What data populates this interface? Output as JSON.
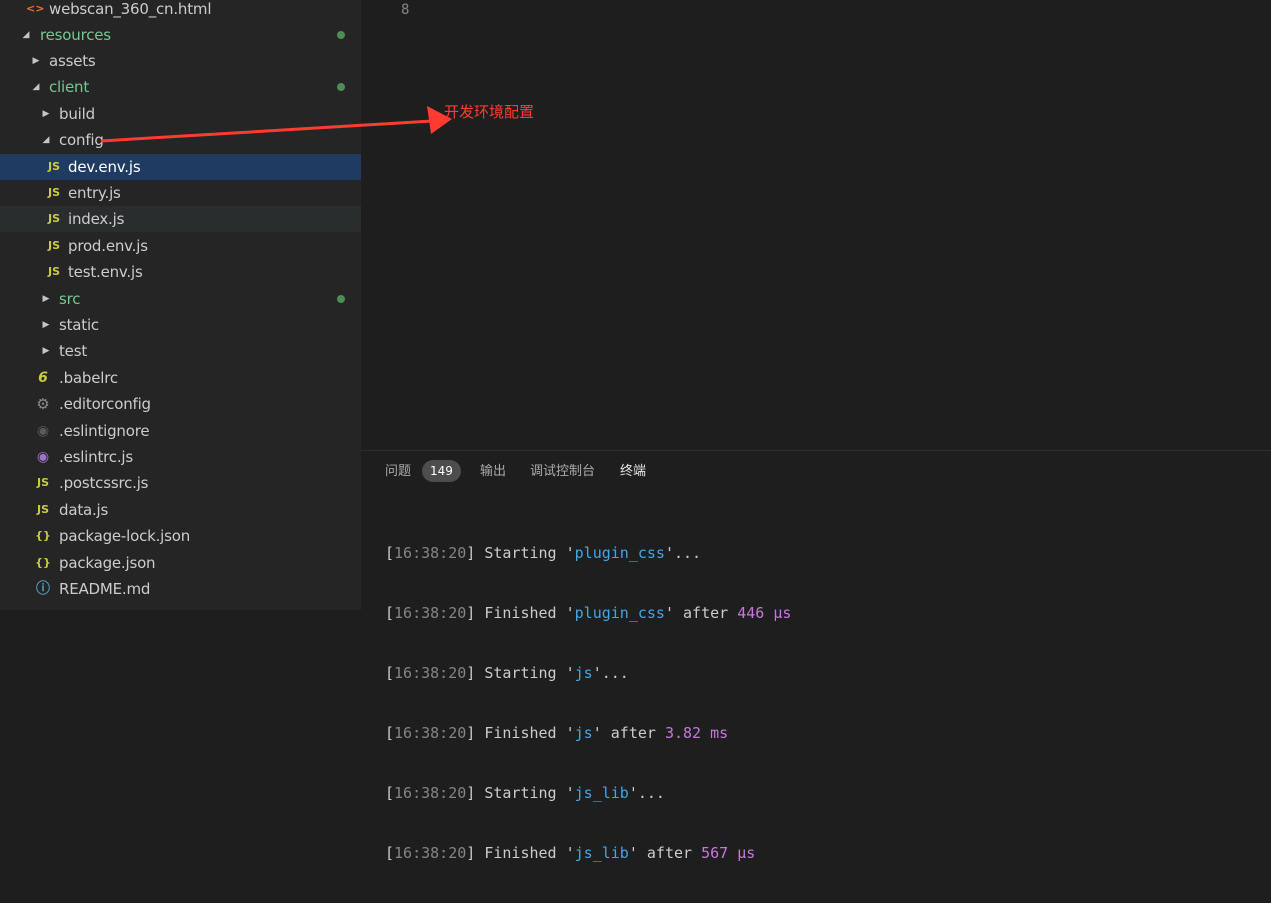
{
  "colors": {
    "accent_selected": "#1f3b61",
    "modified_green": "#73c991",
    "js_yellow": "#cbcb41",
    "annotation_red": "#ff3b30",
    "terminal_cyan": "#3ea8e6",
    "terminal_magenta": "#c678dd"
  },
  "sidebar": {
    "items": [
      {
        "label": "webscan_360_cn.html",
        "icon": "html-code-icon",
        "twisty": ""
      },
      {
        "label": "resources",
        "icon": "",
        "twisty": "◢",
        "modified": true
      },
      {
        "label": "assets",
        "icon": "",
        "twisty": "▶"
      },
      {
        "label": "client",
        "icon": "",
        "twisty": "◢",
        "modified": true
      },
      {
        "label": "build",
        "icon": "",
        "twisty": "▶"
      },
      {
        "label": "config",
        "icon": "",
        "twisty": "◢"
      },
      {
        "label": "dev.env.js",
        "icon": "JS",
        "twisty": "",
        "selected": true
      },
      {
        "label": "entry.js",
        "icon": "JS",
        "twisty": ""
      },
      {
        "label": "index.js",
        "icon": "JS",
        "twisty": "",
        "hover": true
      },
      {
        "label": "prod.env.js",
        "icon": "JS",
        "twisty": ""
      },
      {
        "label": "test.env.js",
        "icon": "JS",
        "twisty": ""
      },
      {
        "label": "src",
        "icon": "",
        "twisty": "▶",
        "modified": true
      },
      {
        "label": "static",
        "icon": "",
        "twisty": "▶"
      },
      {
        "label": "test",
        "icon": "",
        "twisty": "▶"
      },
      {
        "label": ".babelrc",
        "icon": "6",
        "twisty": ""
      },
      {
        "label": ".editorconfig",
        "icon": "⚙",
        "twisty": ""
      },
      {
        "label": ".eslintignore",
        "icon": "◉",
        "twisty": ""
      },
      {
        "label": ".eslintrc.js",
        "icon": "◉",
        "twisty": ""
      },
      {
        "label": ".postcssrc.js",
        "icon": "JS",
        "twisty": ""
      },
      {
        "label": "data.js",
        "icon": "JS",
        "twisty": ""
      },
      {
        "label": "package-lock.json",
        "icon": "{}",
        "twisty": ""
      },
      {
        "label": "package.json",
        "icon": "{}",
        "twisty": ""
      },
      {
        "label": "README.md",
        "icon": "ⓘ",
        "twisty": ""
      }
    ]
  },
  "editor": {
    "line_number": "8",
    "annotation_text": "开发环境配置"
  },
  "panel": {
    "tabs": [
      {
        "label": "问题"
      },
      {
        "label": "输出"
      },
      {
        "label": "调试控制台"
      },
      {
        "label": "终端",
        "active": true
      }
    ],
    "problems_count": "149"
  },
  "terminal": {
    "lines": [
      {
        "ts": "16:38:20",
        "verb": "Starting",
        "task": "plugin_css",
        "tail": "...",
        "after": "",
        "dur": ""
      },
      {
        "ts": "16:38:20",
        "verb": "Finished",
        "task": "plugin_css",
        "tail": "",
        "after": " after ",
        "dur": "446 μs"
      },
      {
        "ts": "16:38:20",
        "verb": "Starting",
        "task": "js",
        "tail": "...",
        "after": "",
        "dur": ""
      },
      {
        "ts": "16:38:20",
        "verb": "Finished",
        "task": "js",
        "tail": "",
        "after": " after ",
        "dur": "3.82 ms"
      },
      {
        "ts": "16:38:20",
        "verb": "Starting",
        "task": "js_lib",
        "tail": "...",
        "after": "",
        "dur": ""
      },
      {
        "ts": "16:38:20",
        "verb": "Finished",
        "task": "js_lib",
        "tail": "",
        "after": " after ",
        "dur": "567 μs"
      }
    ]
  }
}
